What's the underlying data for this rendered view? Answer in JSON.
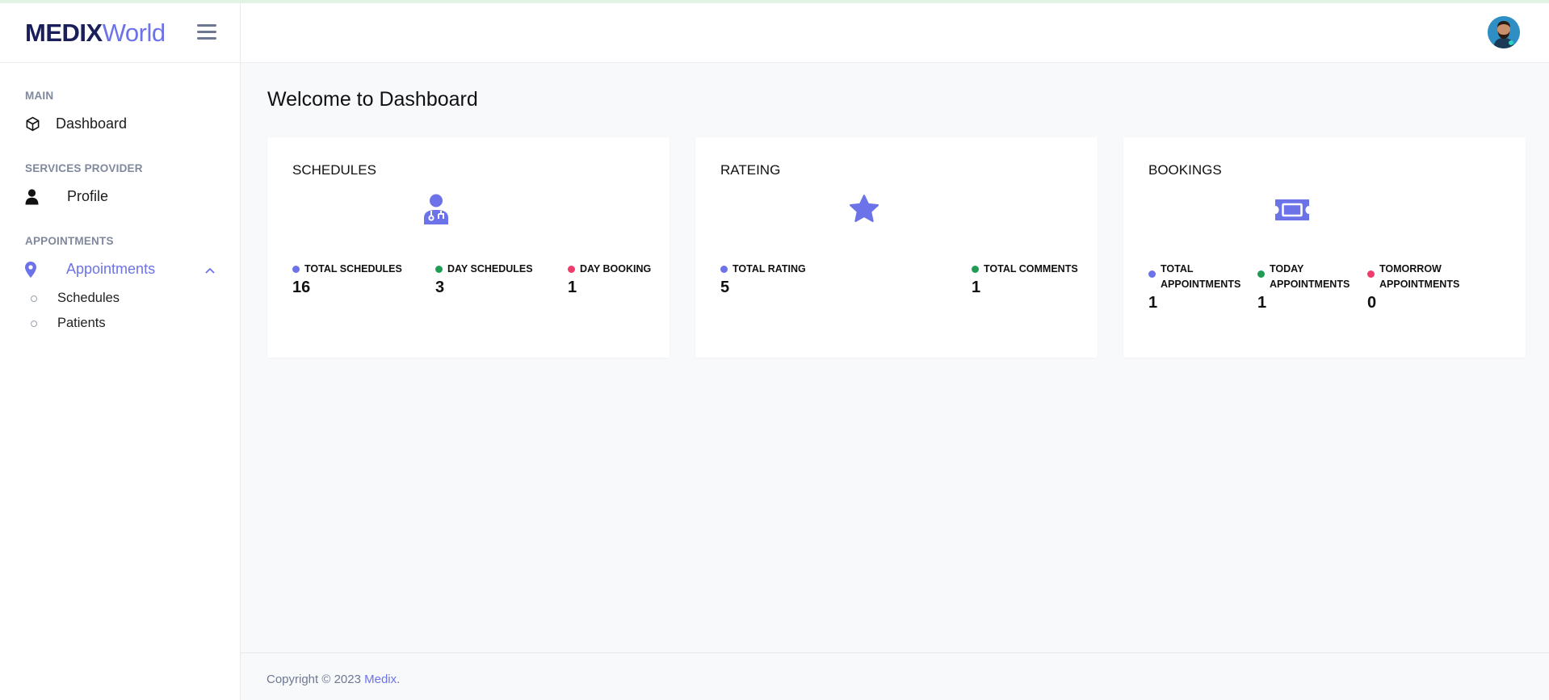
{
  "brand": {
    "name_strong": "MEDIX",
    "name_light": "World"
  },
  "sidebar": {
    "sections": [
      {
        "title": "MAIN"
      },
      {
        "title": "SERVICES PROVIDER"
      },
      {
        "title": "APPOINTMENTS"
      }
    ],
    "items": {
      "dashboard": "Dashboard",
      "profile": "Profile",
      "appointments": "Appointments",
      "schedules": "Schedules",
      "patients": "Patients"
    }
  },
  "main": {
    "title": "Welcome to Dashboard"
  },
  "cards": [
    {
      "title": "SCHEDULES",
      "icon": "doctor-icon",
      "stats": [
        {
          "label": "TOTAL SCHEDULES",
          "value": "16",
          "color": "#6c72e8"
        },
        {
          "label": "DAY SCHEDULES",
          "value": "3",
          "color": "#1f9d55"
        },
        {
          "label": "DAY BOOKING",
          "value": "1",
          "color": "#ef3c6b"
        }
      ]
    },
    {
      "title": "RATEING",
      "icon": "star-icon",
      "stats": [
        {
          "label": "TOTAL RATING",
          "value": "5",
          "color": "#6c72e8"
        },
        {
          "label": "TOTAL COMMENTS",
          "value": "1",
          "color": "#1f9d55"
        }
      ]
    },
    {
      "title": "BOOKINGS",
      "icon": "ticket-icon",
      "stats": [
        {
          "label_line1": "TOTAL",
          "label_line2": "APPOINTMENTS",
          "value": "1",
          "color": "#6c72e8"
        },
        {
          "label_line1": "TODAY",
          "label_line2": "APPOINTMENTS",
          "value": "1",
          "color": "#1f9d55"
        },
        {
          "label_line1": "TOMORROW",
          "label_line2": "APPOINTMENTS",
          "value": "0",
          "color": "#ef3c6b"
        }
      ]
    }
  ],
  "footer": {
    "text": "Copyright © 2023 ",
    "link": "Medix",
    "suffix": "."
  },
  "colors": {
    "accent": "#6c72e8",
    "green": "#1f9d55",
    "red": "#ef3c6b"
  }
}
